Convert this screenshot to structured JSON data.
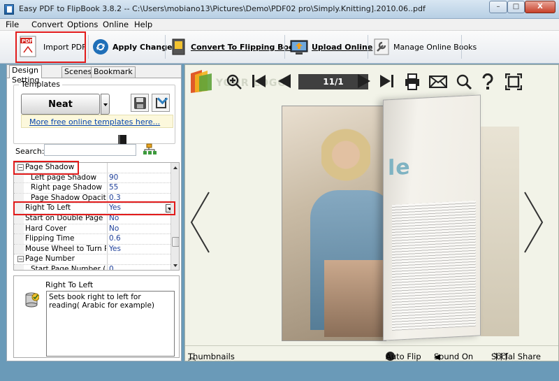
{
  "window": {
    "title": "Easy PDF to FlipBook 3.8.2  -- C:\\Users\\mobiano13\\Pictures\\Demo\\PDF02 pro\\Simply.Knitting].2010.06..pdf",
    "min": "–",
    "max": "□",
    "close": "X"
  },
  "menu": {
    "file": "File",
    "convert": "Convert",
    "options": "Options",
    "online": "Online",
    "help": "Help"
  },
  "toolbar": {
    "import_pdf": "Import PDF",
    "apply_change": "Apply Change",
    "convert": "Convert To Flipping Book",
    "upload": "Upload Online",
    "manage": "Manage Online Books"
  },
  "tabs": {
    "design": "Design Setting",
    "scenes": "Scenes",
    "bookmark": "Bookmark"
  },
  "templates": {
    "title": "Templates",
    "selected": "Neat",
    "more_link": "More free online templates here..."
  },
  "search": {
    "label": "Search:",
    "value": ""
  },
  "properties": {
    "rows": [
      {
        "name": "Page Shadow",
        "value": "",
        "category": true
      },
      {
        "name": "Left page Shadow",
        "value": "90"
      },
      {
        "name": "Right page Shadow",
        "value": "55"
      },
      {
        "name": "Page Shadow Opacity",
        "value": "0.3"
      },
      {
        "name": "Right To Left",
        "value": "Yes",
        "selected": true
      },
      {
        "name": "Start on Double Page",
        "value": "No"
      },
      {
        "name": "Hard Cover",
        "value": "No"
      },
      {
        "name": "Flipping Time",
        "value": "0.6"
      },
      {
        "name": "Mouse Wheel to Turn P...",
        "value": "Yes"
      },
      {
        "name": "Page Number",
        "value": "",
        "category": true
      },
      {
        "name": "Start Page Number (R...",
        "value": "0"
      }
    ]
  },
  "description": {
    "title": "Right To Left",
    "text": "Sets book right to left for reading( Arabic for example)"
  },
  "viewer": {
    "logo_text": "YOUR LOGO",
    "page_indicator": "11/1",
    "magazine_title": "le",
    "bottom": {
      "thumbnails": "Thumbnails",
      "auto_flip": "Auto Flip",
      "sound": "Sound On",
      "social": "Social Share"
    }
  },
  "colors": {
    "highlight": "#e21b1b",
    "link": "#0645ad",
    "value_text": "#1e3f99"
  }
}
